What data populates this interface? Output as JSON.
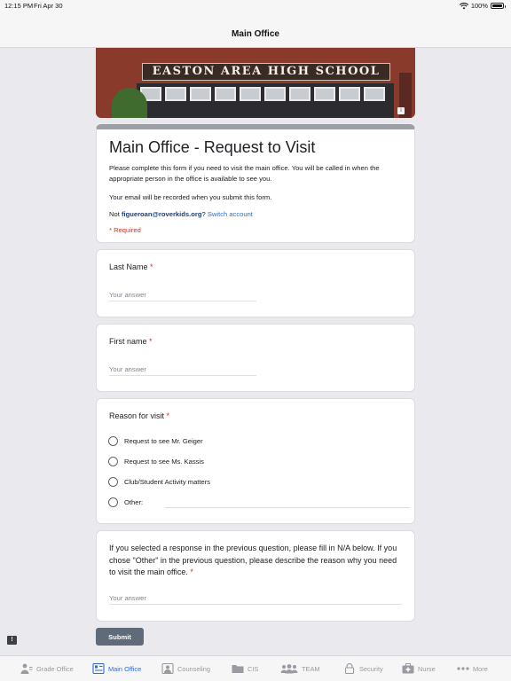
{
  "status_bar": {
    "time": "12:15 PM",
    "date": "Fri Apr 30",
    "battery": "100%",
    "battery_level": 1.0,
    "wifi_icon": "wifi-icon",
    "battery_icon": "battery-icon"
  },
  "nav": {
    "title": "Main Office"
  },
  "header_image": {
    "sign_text": "EASTON AREA HIGH SCHOOL"
  },
  "form": {
    "title": "Main Office - Request to Visit",
    "description": "Please complete this form if you need to visit the main office. You will be called in when the appropriate person in the office is available to see you.",
    "email_note": "Your email will be recorded when you submit this form.",
    "account_prefix": "Not ",
    "account_email": "figueroan@roverkids.org",
    "account_suffix": "?",
    "switch_account": "Switch account",
    "required_note": "* Required"
  },
  "questions": {
    "last_name": {
      "label": "Last Name",
      "required_mark": "*",
      "placeholder": "Your answer"
    },
    "first_name": {
      "label": "First name",
      "required_mark": "*",
      "placeholder": "Your answer"
    },
    "reason": {
      "label": "Reason for visit",
      "required_mark": "*",
      "options": [
        "Request to see Mr. Geiger",
        "Request to see Ms. Kassis",
        "Club/Student Activity matters",
        "Other:"
      ]
    },
    "explain": {
      "label": "If you selected a response in the previous question, please fill in N/A below. If you chose \"Other\" in the previous question, please describe the reason why you need to visit the main office.",
      "required_mark": "*",
      "placeholder": "Your answer"
    }
  },
  "submit_label": "Submit",
  "feedback_glyph": "!",
  "tabs": [
    {
      "label": "Grade Office",
      "icon": "person-icon",
      "active": false
    },
    {
      "label": "Main Office",
      "icon": "building-icon",
      "active": true
    },
    {
      "label": "Counseling",
      "icon": "counseling-icon",
      "active": false
    },
    {
      "label": "CIS",
      "icon": "folder-icon",
      "active": false
    },
    {
      "label": "TEAM",
      "icon": "group-icon",
      "active": false
    },
    {
      "label": "Security",
      "icon": "lock-icon",
      "active": false
    },
    {
      "label": "Nurse",
      "icon": "medical-kit-icon",
      "active": false
    },
    {
      "label": "More",
      "icon": "more-icon",
      "active": false
    }
  ],
  "colors": {
    "accent": "#1a73e8",
    "required": "#d93025",
    "active_tab": "#2f6bd8",
    "submit": "#5f6b78"
  }
}
